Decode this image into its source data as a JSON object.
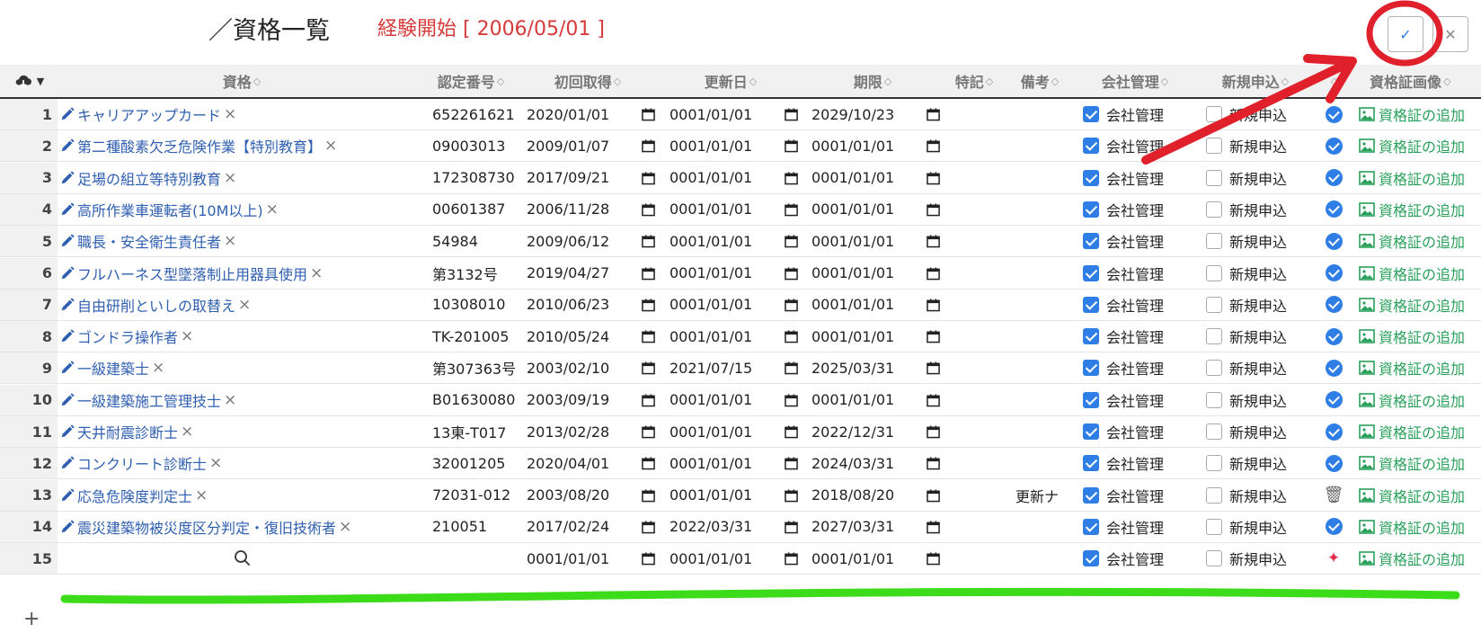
{
  "header": {
    "title": "／資格一覧",
    "experience_start": "経験開始 [ 2006/05/01 ]",
    "experience_color": "#d63a3a",
    "confirm_icon": "check-icon",
    "close_icon": "close-icon"
  },
  "table": {
    "menu_icon": "cloud-download-icon",
    "columns": [
      "資格",
      "認定番号",
      "初回取得",
      "更新日",
      "期限",
      "特記",
      "備考",
      "会社管理",
      "新規申込",
      "",
      "資格証画像"
    ],
    "company_label": "会社管理",
    "new_label": "新規申込",
    "image_label": "資格証の追加",
    "rows": [
      {
        "no": "1",
        "name": "キャリアアップカード",
        "cert": "652261621",
        "first": "2020/01/01",
        "renew": "0001/01/01",
        "expire": "2029/10/23",
        "note": "",
        "company": true,
        "new": false,
        "status": "check"
      },
      {
        "no": "2",
        "name": "第二種酸素欠乏危険作業【特別教育】",
        "cert": "09003013",
        "first": "2009/01/07",
        "renew": "0001/01/01",
        "expire": "0001/01/01",
        "note": "",
        "company": true,
        "new": false,
        "status": "check"
      },
      {
        "no": "3",
        "name": "足場の組立等特別教育",
        "cert": "172308730",
        "first": "2017/09/21",
        "renew": "0001/01/01",
        "expire": "0001/01/01",
        "note": "",
        "company": true,
        "new": false,
        "status": "check"
      },
      {
        "no": "4",
        "name": "高所作業車運転者(10M以上)",
        "cert": "00601387",
        "first": "2006/11/28",
        "renew": "0001/01/01",
        "expire": "0001/01/01",
        "note": "",
        "company": true,
        "new": false,
        "status": "check"
      },
      {
        "no": "5",
        "name": "職長・安全衛生責任者",
        "cert": "54984",
        "first": "2009/06/12",
        "renew": "0001/01/01",
        "expire": "0001/01/01",
        "note": "",
        "company": true,
        "new": false,
        "status": "check"
      },
      {
        "no": "6",
        "name": "フルハーネス型墜落制止用器具使用",
        "cert": "第3132号",
        "first": "2019/04/27",
        "renew": "0001/01/01",
        "expire": "0001/01/01",
        "note": "",
        "company": true,
        "new": false,
        "status": "check"
      },
      {
        "no": "7",
        "name": "自由研削といしの取替え",
        "cert": "10308010",
        "first": "2010/06/23",
        "renew": "0001/01/01",
        "expire": "0001/01/01",
        "note": "",
        "company": true,
        "new": false,
        "status": "check"
      },
      {
        "no": "8",
        "name": "ゴンドラ操作者",
        "cert": "TK-201005",
        "first": "2010/05/24",
        "renew": "0001/01/01",
        "expire": "0001/01/01",
        "note": "",
        "company": true,
        "new": false,
        "status": "check"
      },
      {
        "no": "9",
        "name": "一級建築士",
        "cert": "第307363号",
        "first": "2003/02/10",
        "renew": "2021/07/15",
        "expire": "2025/03/31",
        "note": "",
        "company": true,
        "new": false,
        "status": "check"
      },
      {
        "no": "10",
        "name": "一級建築施工管理技士",
        "cert": "B01630080",
        "first": "2003/09/19",
        "renew": "0001/01/01",
        "expire": "0001/01/01",
        "note": "",
        "company": true,
        "new": false,
        "status": "check"
      },
      {
        "no": "11",
        "name": "天井耐震診断士",
        "cert": "13東-T017",
        "first": "2013/02/28",
        "renew": "0001/01/01",
        "expire": "2022/12/31",
        "note": "",
        "company": true,
        "new": false,
        "status": "check"
      },
      {
        "no": "12",
        "name": "コンクリート診断士",
        "cert": "32001205",
        "first": "2020/04/01",
        "renew": "0001/01/01",
        "expire": "2024/03/31",
        "note": "",
        "company": true,
        "new": false,
        "status": "check"
      },
      {
        "no": "13",
        "name": "応急危険度判定士",
        "cert": "72031-012",
        "first": "2003/08/20",
        "renew": "0001/01/01",
        "expire": "2018/08/20",
        "note": "更新ナ",
        "company": true,
        "new": false,
        "status": "trash"
      },
      {
        "no": "14",
        "name": "震災建築物被災度区分判定・復旧技術者",
        "cert": "210051",
        "first": "2017/02/24",
        "renew": "2022/03/31",
        "expire": "2027/03/31",
        "note": "",
        "company": true,
        "new": false,
        "status": "check"
      },
      {
        "no": "15",
        "name": "",
        "cert": "",
        "first": "0001/01/01",
        "renew": "0001/01/01",
        "expire": "0001/01/01",
        "note": "",
        "company": true,
        "new": false,
        "status": "sparkle"
      }
    ]
  },
  "colors": {
    "annotation_red": "#e0202a",
    "annotation_green": "#3ddc1a",
    "link": "#2f5fb0",
    "accent": "#2f7ee6",
    "image_green": "#28a05a"
  },
  "add_row": "+"
}
